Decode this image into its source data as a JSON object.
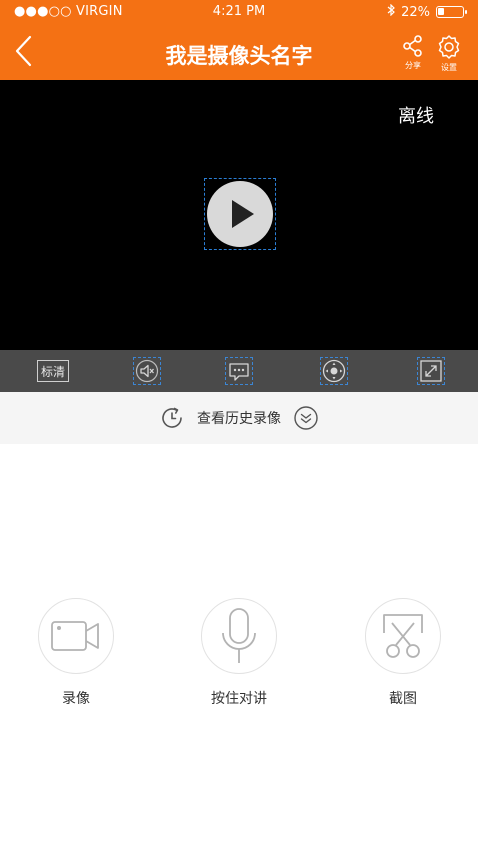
{
  "status": {
    "carrier": "●●●○○ VIRGIN",
    "time": "4:21 PM",
    "battery_text": "22%"
  },
  "nav": {
    "title": "我是摄像头名字",
    "share_label": "分享",
    "settings_label": "设置"
  },
  "video": {
    "status_text": "离线"
  },
  "toolbar": {
    "quality_label": "标清"
  },
  "history": {
    "label": "查看历史录像"
  },
  "actions": [
    {
      "label": "录像"
    },
    {
      "label": "按住对讲"
    },
    {
      "label": "截图"
    }
  ],
  "colors": {
    "brand": "#f47114",
    "video_bg": "#000000",
    "toolbar_bg": "#4a4a4a"
  }
}
